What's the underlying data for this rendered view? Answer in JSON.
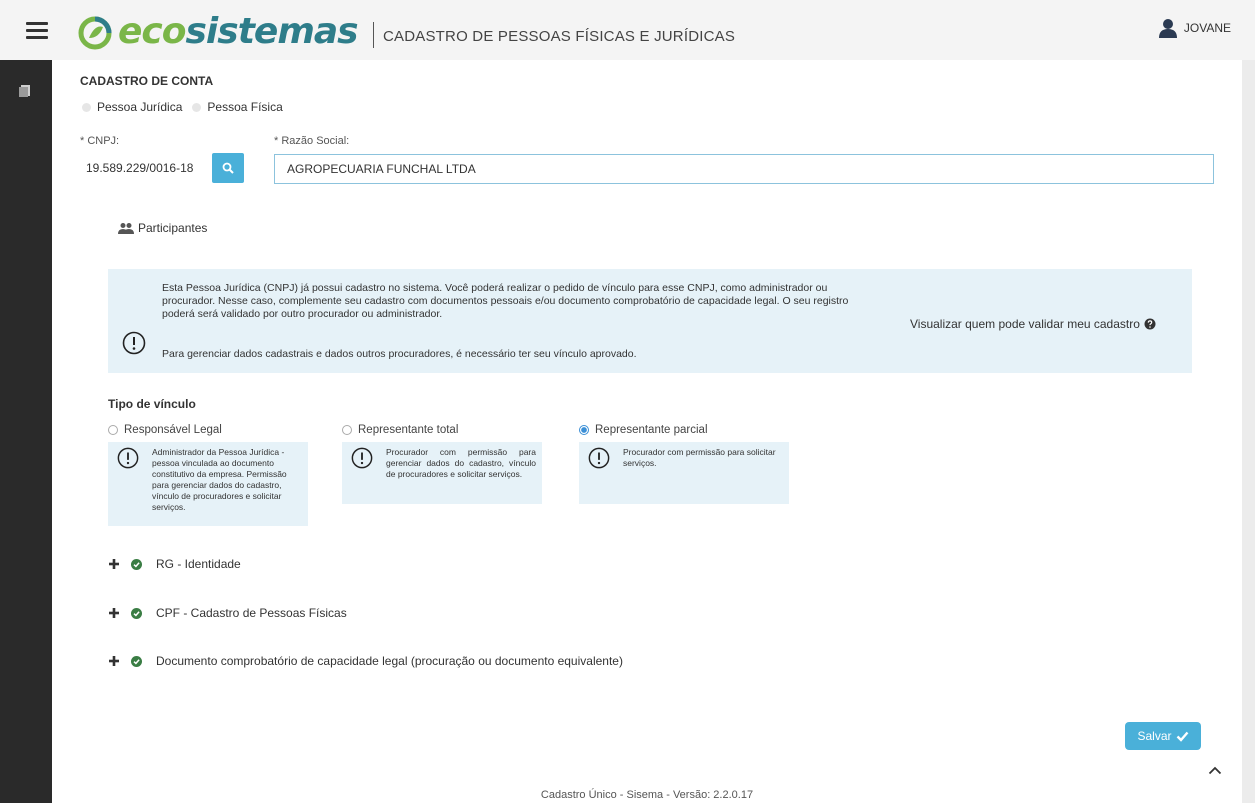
{
  "header": {
    "brand_eco": "eco",
    "brand_sistemas": "sistemas",
    "page_heading": "CADASTRO DE PESSOAS FÍSICAS E JURÍDICAS",
    "user_name": "JOVANE"
  },
  "form": {
    "section_title": "CADASTRO DE CONTA",
    "tabs": [
      {
        "label": "Pessoa Jurídica"
      },
      {
        "label": "Pessoa Física"
      }
    ],
    "cnpj_label": "* CNPJ:",
    "cnpj_value": "19.589.229/0016-18",
    "razao_label": "* Razão Social:",
    "razao_value": "AGROPECUARIA FUNCHAL LTDA",
    "participantes_label": "Participantes"
  },
  "alert": {
    "message": "Esta Pessoa Jurídica (CNPJ) já possui cadastro no sistema. Você poderá realizar o pedido de vínculo para esse CNPJ, como administrador ou procurador. Nesse caso, complemente seu cadastro com documentos pessoais e/ou documento comprobatório de capacidade legal. O seu registro poderá será validado por outro procurador ou administrador.",
    "message2": "Para gerenciar dados cadastrais e dados outros procuradores, é necessário ter seu vínculo aprovado.",
    "link_label": "Visualizar quem pode validar meu cadastro"
  },
  "vinculo": {
    "title": "Tipo de vínculo",
    "options": [
      {
        "label": "Responsável Legal",
        "selected": false,
        "description": "Administrador da Pessoa Jurídica - pessoa vinculada ao documento constitutivo da empresa. Permissão para gerenciar dados do cadastro, vínculo de procuradores e solicitar serviços."
      },
      {
        "label": "Representante total",
        "selected": false,
        "description": "Procurador com permissão para gerenciar dados do cadastro, vínculo de procuradores e solicitar serviços."
      },
      {
        "label": "Representante parcial",
        "selected": true,
        "description": "Procurador com permissão para solicitar serviços."
      }
    ]
  },
  "documents": [
    {
      "label": "RG - Identidade"
    },
    {
      "label": "CPF - Cadastro de Pessoas Físicas"
    },
    {
      "label": "Documento comprobatório de capacidade legal (procuração ou documento equivalente)"
    }
  ],
  "actions": {
    "save_label": "Salvar"
  },
  "footer": {
    "text": "Cadastro Único - Sisema - Versão: 2.2.0.17"
  },
  "colors": {
    "accent": "#4ab0d9",
    "info_bg": "#e6f2f8",
    "sidebar": "#2a2a2a",
    "brand_green": "#7ab648",
    "brand_teal": "#2e7d8a",
    "check_green": "#3a7d44"
  },
  "icons": [
    "menu-icon",
    "logo-icon",
    "user-icon",
    "document-icon",
    "search-icon",
    "users-icon",
    "alert-icon",
    "question-circle-icon",
    "plus-icon",
    "check-circle-icon",
    "checkmark-icon",
    "chevron-up-icon"
  ]
}
